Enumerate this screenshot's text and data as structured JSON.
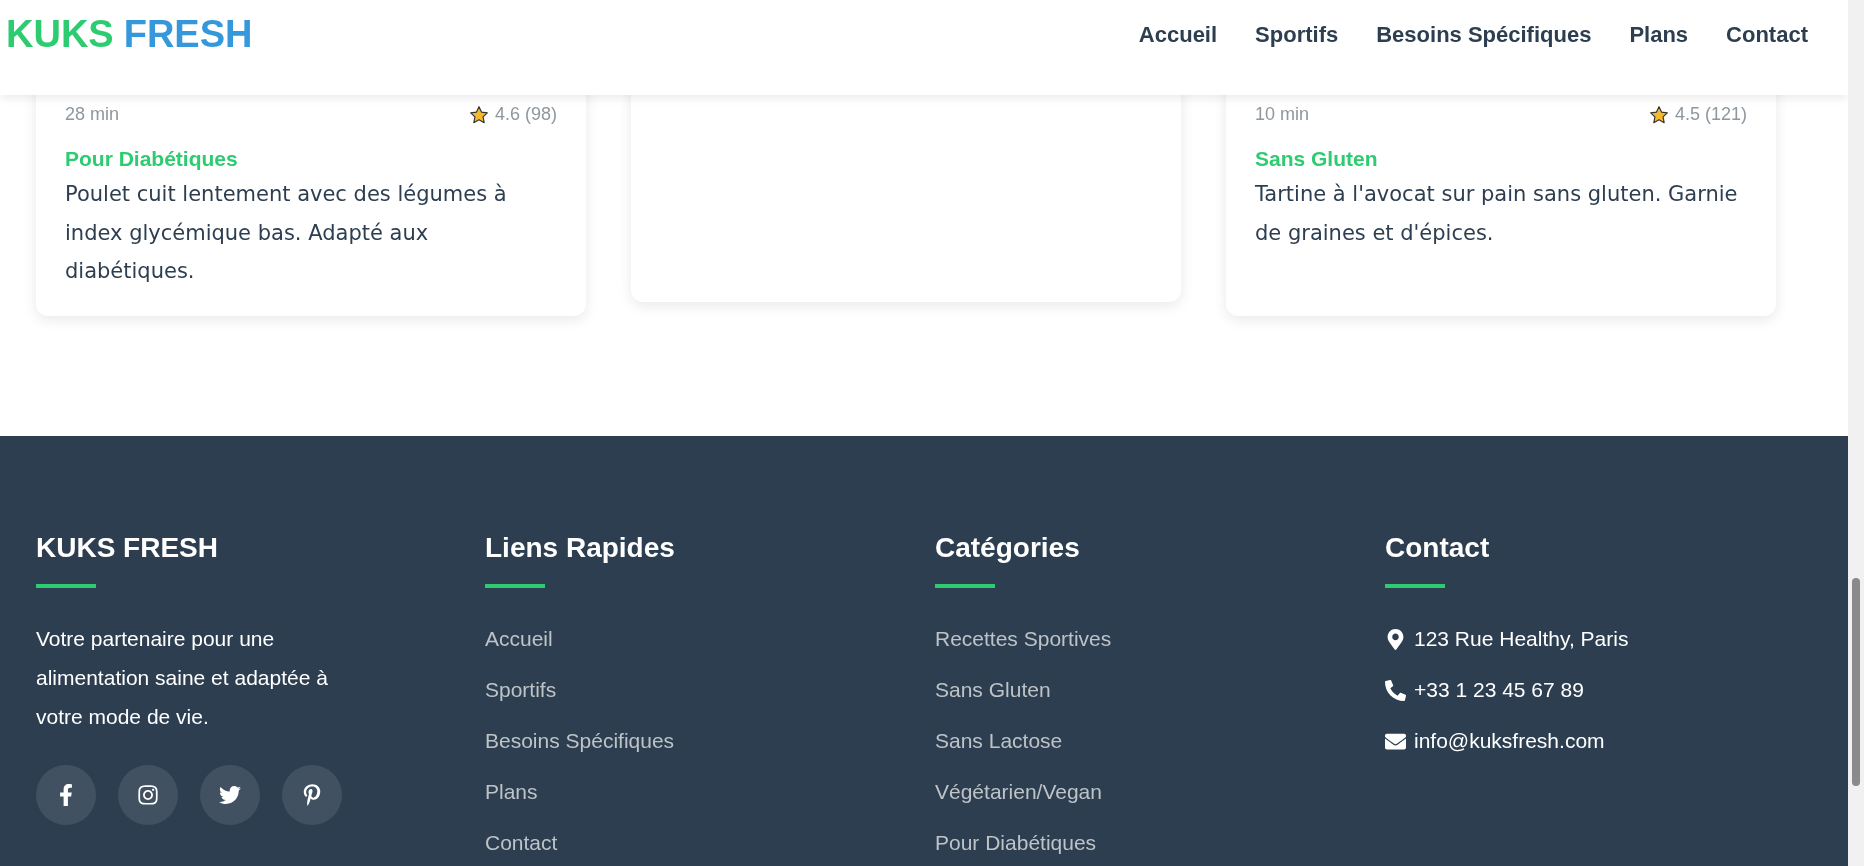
{
  "header": {
    "logo": [
      {
        "text": "KUKS",
        "color": "#2ecc71"
      },
      {
        "text": "FRESH",
        "color": "#3498db"
      }
    ],
    "nav": [
      {
        "label": "Accueil"
      },
      {
        "label": "Sportifs"
      },
      {
        "label": "Besoins Spécifiques"
      },
      {
        "label": "Plans"
      },
      {
        "label": "Contact"
      }
    ]
  },
  "cards": [
    {
      "kind": "recipe",
      "time": "28 min",
      "rating": "4.6 (98)",
      "category": "Pour Diabétiques",
      "description": "Poulet cuit lentement avec des légumes à index glycémique bas. Adapté aux diabétiques."
    },
    {
      "kind": "blank"
    },
    {
      "kind": "recipe",
      "time": "10 min",
      "rating": "4.5 (121)",
      "category": "Sans Gluten",
      "description": "Tartine à l'avocat sur pain sans gluten. Garnie de graines et d'épices."
    }
  ],
  "footer": {
    "about": {
      "title": "KUKS FRESH",
      "text": "Votre partenaire pour une alimentation saine et adaptée à votre mode de vie.",
      "socials": [
        {
          "kind": "facebook"
        },
        {
          "kind": "instagram"
        },
        {
          "kind": "twitter"
        },
        {
          "kind": "pinterest"
        }
      ]
    },
    "link_columns": [
      {
        "title": "Liens Rapides",
        "links": [
          "Accueil",
          "Sportifs",
          "Besoins Spécifiques",
          "Plans",
          "Contact"
        ]
      },
      {
        "title": "Catégories",
        "links": [
          "Recettes Sportives",
          "Sans Gluten",
          "Sans Lactose",
          "Végétarien/Vegan",
          "Pour Diabétiques"
        ]
      }
    ],
    "contact": {
      "title": "Contact",
      "items": [
        {
          "kind": "address",
          "text": "123 Rue Healthy, Paris"
        },
        {
          "kind": "phone",
          "text": "+33 1 23 45 67 89"
        },
        {
          "kind": "email",
          "text": "info@kuksfresh.com"
        }
      ]
    }
  }
}
